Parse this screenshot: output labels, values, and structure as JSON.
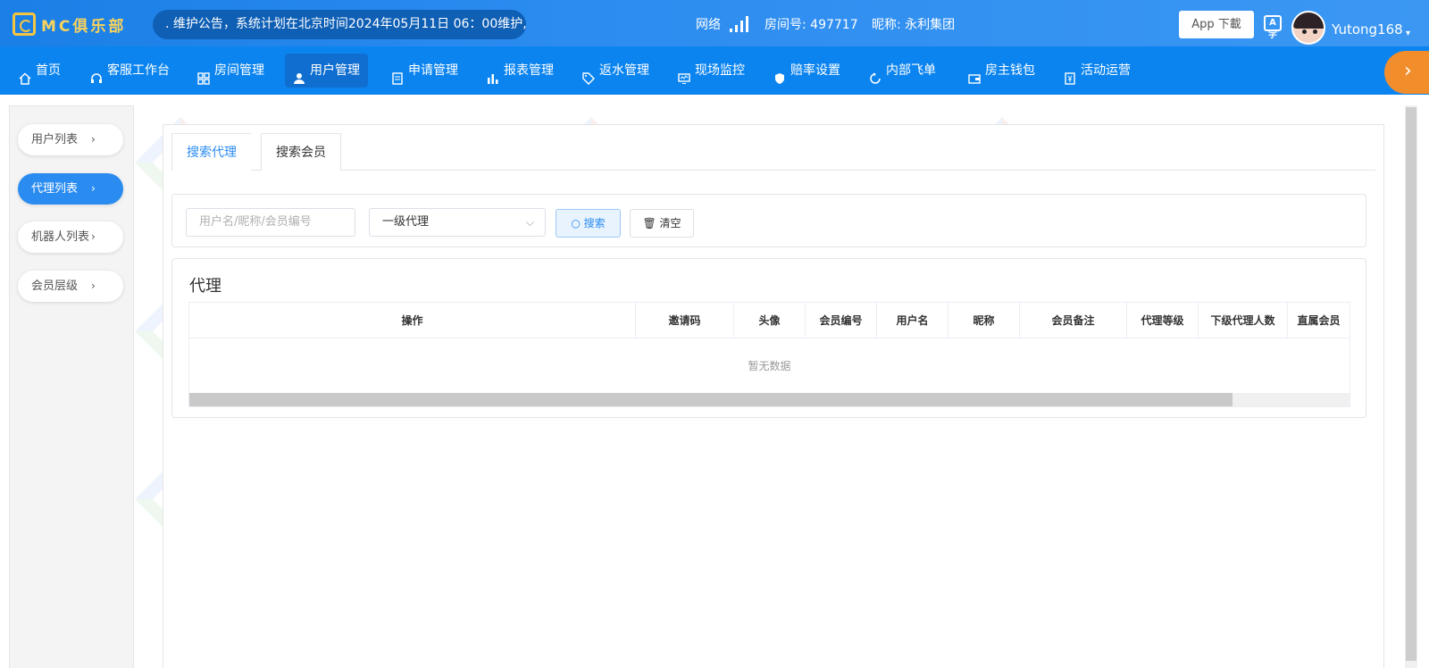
{
  "header": {
    "brand": "MC俱乐部",
    "notice": ". 维护公告，系统计划在北京时间2024年05月11日 06：00维护,",
    "network_label": "网络",
    "room_label": "房间号: 497717",
    "nick_label": "昵称: 永利集团",
    "app_download": "App 下載",
    "translate_icon": "A字",
    "username": "Yutong168",
    "user_caret": "▾"
  },
  "nav": {
    "items": [
      {
        "label": "首页",
        "icon": "home-icon"
      },
      {
        "label": "客服工作台",
        "icon": "headset-icon"
      },
      {
        "label": "房间管理",
        "icon": "grid-icon"
      },
      {
        "label": "用户管理",
        "icon": "user-icon"
      },
      {
        "label": "申请管理",
        "icon": "document-icon"
      },
      {
        "label": "报表管理",
        "icon": "bar-chart-icon"
      },
      {
        "label": "返水管理",
        "icon": "tag-icon"
      },
      {
        "label": "现场监控",
        "icon": "monitor-icon"
      },
      {
        "label": "赔率设置",
        "icon": "shield-yen-icon"
      },
      {
        "label": "内部飞单",
        "icon": "refresh-icon"
      },
      {
        "label": "房主钱包",
        "icon": "wallet-icon"
      },
      {
        "label": "活动运营",
        "icon": "yen-doc-icon"
      }
    ],
    "active_index": 3,
    "more_arrow": "›"
  },
  "sidebar": {
    "items": [
      {
        "label": "用户列表"
      },
      {
        "label": "代理列表"
      },
      {
        "label": "机器人列表"
      },
      {
        "label": "会员层级"
      }
    ],
    "active_index": 1,
    "chevron": "›"
  },
  "tabs": {
    "search_agent": "搜索代理",
    "search_member": "搜索会员"
  },
  "search": {
    "placeholder": "用户名/昵称/会员编号",
    "level_value": "一级代理",
    "search_btn": "搜索",
    "clear_btn": "清空"
  },
  "agent": {
    "title": "代理",
    "columns": [
      "操作",
      "邀请码",
      "头像",
      "会员编号",
      "用户名",
      "昵称",
      "会员备注",
      "代理等级",
      "下级代理人数",
      "直属会员"
    ],
    "empty_text": "暂无数据"
  },
  "watermark": {
    "text": "久麒包网",
    "sub": "97BW.COM"
  },
  "colors": {
    "topbar": "#2c8cf0",
    "navbar": "#0b84f0",
    "active_nav": "#0f6ed0",
    "accent": "#2a8cf0",
    "orange": "#f28d2c",
    "brand_gold": "#f8d35e"
  }
}
